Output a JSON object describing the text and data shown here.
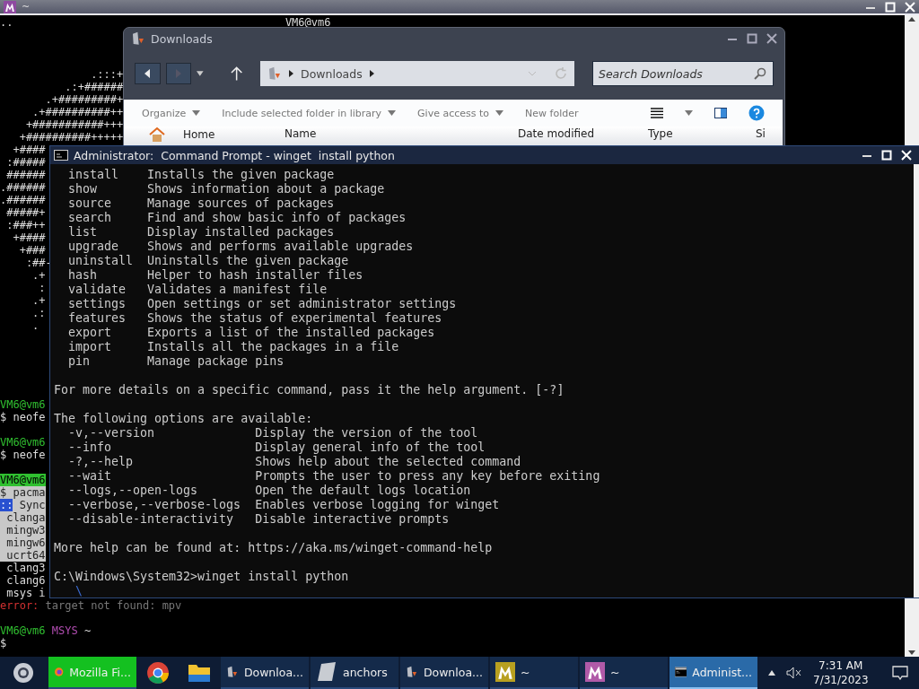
{
  "terminal": {
    "title": "~",
    "top_left": "..",
    "host": "VM6@vm6",
    "logo_lines": [
      "              .:::+",
      "          .:+######",
      "       .+#########+",
      "     .+##########++",
      "    +###########+++",
      "   +##########+++++",
      "  +####",
      " :#####",
      " ######",
      ".######",
      ".######",
      " #####+",
      " :###++",
      "  +####",
      "   +###",
      "    :##-",
      "     .+",
      "      :",
      "     .+",
      "     .:",
      "     ."
    ],
    "blocks": [
      [
        [
          {
            "kind": "user",
            "text": "VM6@vm6"
          }
        ],
        [
          {
            "kind": "text",
            "text": "$ neofe"
          }
        ]
      ],
      [
        [
          {
            "kind": "user",
            "text": "VM6@vm6"
          }
        ],
        [
          {
            "kind": "text",
            "text": "$ neofe"
          }
        ]
      ],
      [
        [
          {
            "kind": "user_highlight",
            "text": "VM6@vm6"
          }
        ],
        [
          {
            "kind": "highlight",
            "text": "$ pacma"
          }
        ],
        [
          {
            "kind": "marker",
            "text": "::"
          },
          {
            "kind": "highlight",
            "text": " Sync"
          }
        ],
        [
          {
            "kind": "highlight",
            "text": " clanga"
          }
        ],
        [
          {
            "kind": "highlight",
            "text": " mingw3"
          }
        ],
        [
          {
            "kind": "highlight",
            "text": " mingw6"
          }
        ],
        [
          {
            "kind": "highlight",
            "text": " ucrt64"
          }
        ],
        [
          {
            "kind": "text",
            "text": " clang3"
          }
        ],
        [
          {
            "kind": "text",
            "text": " clang6"
          }
        ],
        [
          {
            "kind": "text",
            "text": " msys i"
          }
        ],
        [
          {
            "kind": "error",
            "text": "error:"
          },
          {
            "kind": "dim",
            "text": " target not found: mpv"
          }
        ]
      ],
      [
        [
          {
            "kind": "user",
            "text": "VM6@vm6"
          },
          {
            "kind": "shell",
            "text": " MSYS"
          },
          {
            "kind": "text",
            "text": " ~"
          }
        ],
        [
          {
            "kind": "text",
            "text": "$"
          }
        ]
      ]
    ]
  },
  "explorer": {
    "title": "Downloads",
    "breadcrumb": "Downloads",
    "search": {
      "placeholder": "Search Downloads"
    },
    "toolbar": [
      {
        "label": "Organize",
        "dropdown": true
      },
      {
        "label": "Include selected folder in library",
        "dropdown": true
      },
      {
        "label": "Give access to",
        "dropdown": true
      },
      {
        "label": "New folder",
        "dropdown": false
      }
    ],
    "nav_item": "Home",
    "columns": [
      "Name",
      "Date modified",
      "Type",
      "Si"
    ]
  },
  "cmd": {
    "title": "Administrator:  Command Prompt - winget  install python",
    "commands": [
      {
        "name": "install",
        "description": "Installs the given package"
      },
      {
        "name": "show",
        "description": "Shows information about a package"
      },
      {
        "name": "source",
        "description": "Manage sources of packages"
      },
      {
        "name": "search",
        "description": "Find and show basic info of packages"
      },
      {
        "name": "list",
        "description": "Display installed packages"
      },
      {
        "name": "upgrade",
        "description": "Shows and performs available upgrades"
      },
      {
        "name": "uninstall",
        "description": "Uninstalls the given package"
      },
      {
        "name": "hash",
        "description": "Helper to hash installer files"
      },
      {
        "name": "validate",
        "description": "Validates a manifest file"
      },
      {
        "name": "settings",
        "description": "Open settings or set administrator settings"
      },
      {
        "name": "features",
        "description": "Shows the status of experimental features"
      },
      {
        "name": "export",
        "description": "Exports a list of the installed packages"
      },
      {
        "name": "import",
        "description": "Installs all the packages in a file"
      },
      {
        "name": "pin",
        "description": "Manage package pins"
      }
    ],
    "details": "For more details on a specific command, pass it the help argument. [-?]",
    "options_heading": "The following options are available:",
    "options": [
      {
        "flag": "-v,--version",
        "description": "Display the version of the tool"
      },
      {
        "flag": "--info",
        "description": "Display general info of the tool"
      },
      {
        "flag": "-?,--help",
        "description": "Shows help about the selected command"
      },
      {
        "flag": "--wait",
        "description": "Prompts the user to press any key before exiting"
      },
      {
        "flag": "--logs,--open-logs",
        "description": "Open the default logs location"
      },
      {
        "flag": "--verbose,--verbose-logs",
        "description": "Enables verbose logging for winget"
      },
      {
        "flag": "--disable-interactivity",
        "description": "Disable interactive prompts"
      }
    ],
    "help": "More help can be found at: https://aka.ms/winget-command-help",
    "prompt": "C:\\Windows\\System32>winget install python",
    "spinner": "\\"
  },
  "taskbar": {
    "items": [
      {
        "kind": "firefox",
        "label": "Mozilla Fi...",
        "flashing": true,
        "selected": false
      },
      {
        "kind": "chrome",
        "flashing": false,
        "selected": false
      },
      {
        "kind": "folder",
        "flashing": false,
        "selected": false
      },
      {
        "kind": "explorer",
        "label": "Downloa...",
        "flashing": false,
        "selected": false
      },
      {
        "kind": "file",
        "label": "anchors",
        "flashing": false,
        "selected": false
      },
      {
        "kind": "explorer",
        "label": "Downloa...",
        "flashing": false,
        "selected": false
      },
      {
        "kind": "msys",
        "label": "~",
        "color": "#b8a020",
        "flashing": false,
        "selected": false
      },
      {
        "kind": "msys",
        "label": "~",
        "color": "#b05aa8",
        "flashing": false,
        "selected": false
      },
      {
        "kind": "cmd",
        "label": "Administ...",
        "flashing": false,
        "selected": true
      }
    ],
    "time": "7:31 AM",
    "date": "7/31/2023"
  }
}
